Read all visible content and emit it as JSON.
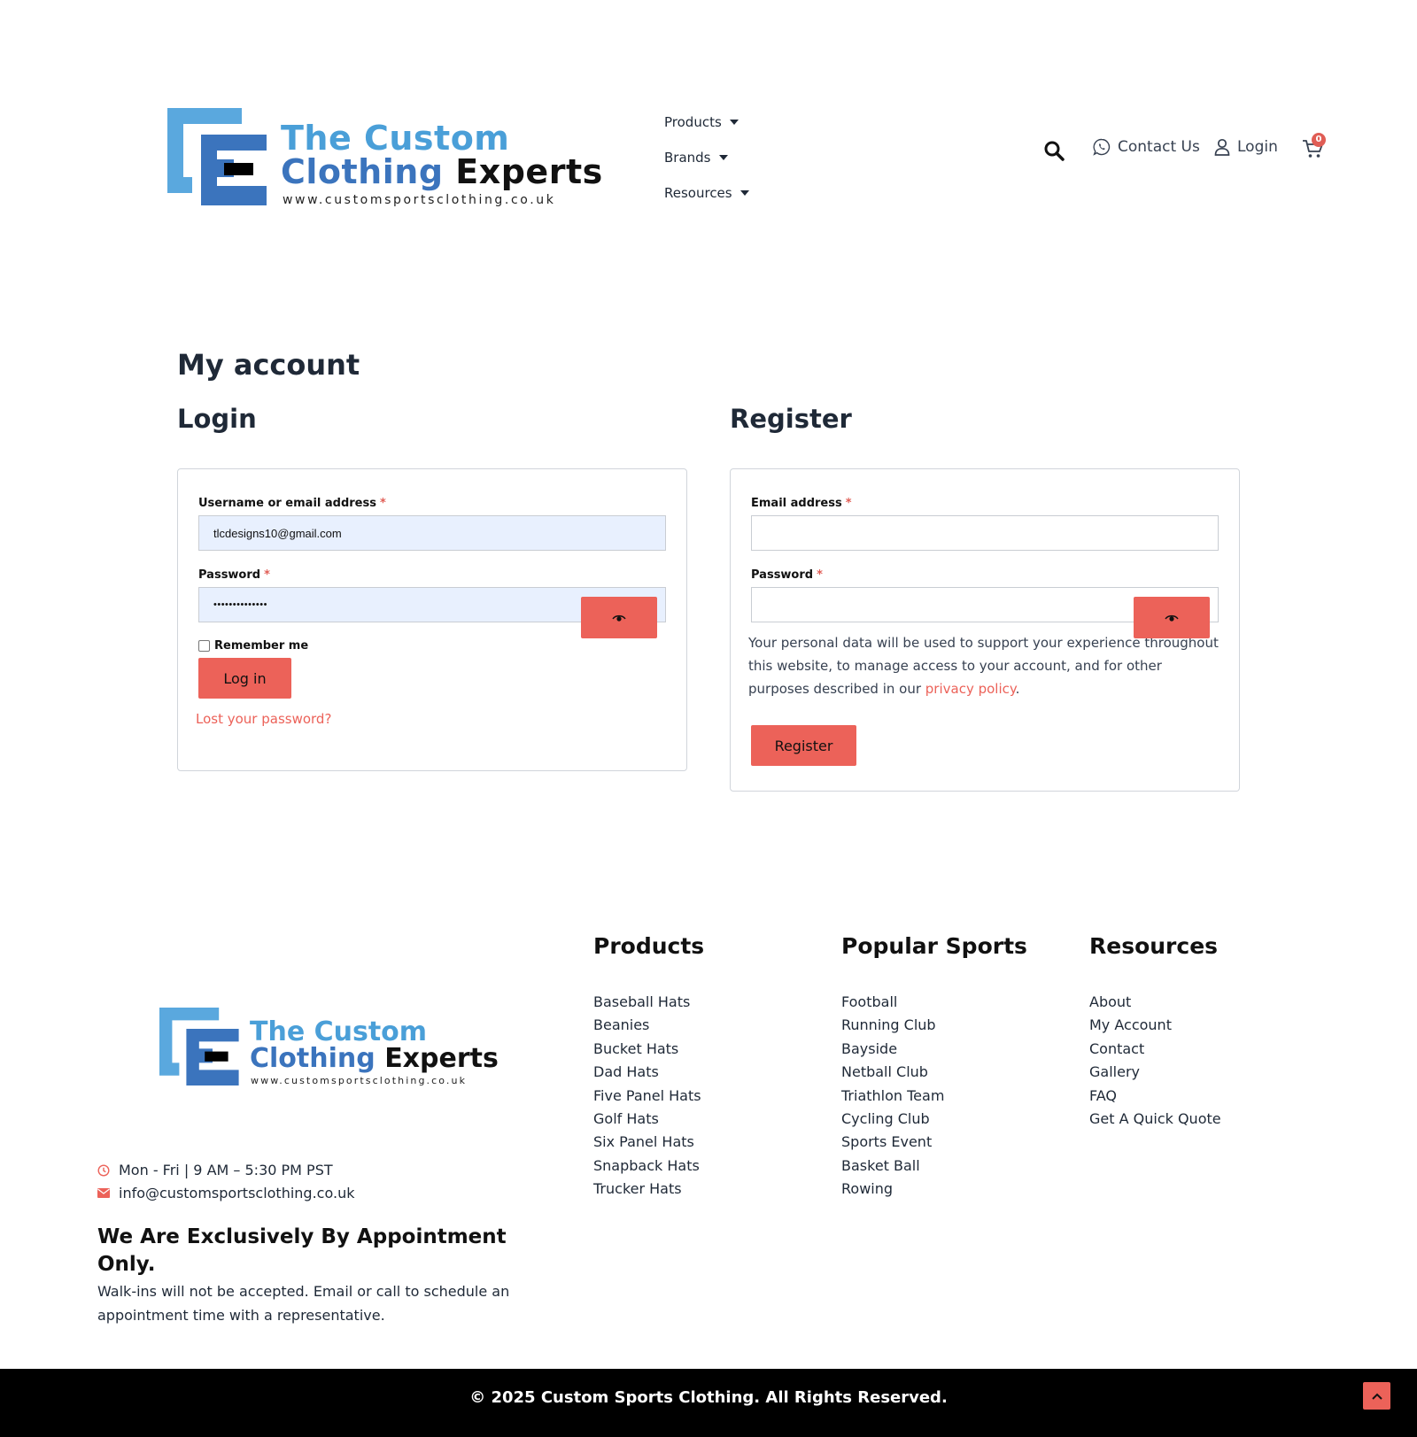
{
  "brand": {
    "line1": "The Custom",
    "line2_colored": "Clothing",
    "line2_dark": "Experts",
    "url": "www.customsportsclothing.co.uk"
  },
  "nav": {
    "products": "Products",
    "brands": "Brands",
    "resources": "Resources",
    "contact": "Contact Us",
    "login": "Login",
    "cart_count": "0"
  },
  "page": {
    "title": "My account"
  },
  "login": {
    "title": "Login",
    "username_label": "Username or email address",
    "username_value": "tlcdesigns10@gmail.com",
    "password_label": "Password",
    "password_value": "••••••••••••••",
    "remember_label": "Remember me",
    "submit_label": "Log in",
    "lost_password": "Lost your password?"
  },
  "register": {
    "title": "Register",
    "email_label": "Email address",
    "password_label": "Password",
    "privacy_text": "Your personal data will be used to support your experience throughout this website, to manage access to your account, and for other purposes described in our ",
    "privacy_link": "privacy policy",
    "privacy_end": ".",
    "submit_label": "Register"
  },
  "required_mark": "*",
  "footer": {
    "hours": "Mon - Fri | 9 AM – 5:30 PM PST",
    "email": "info@customsportsclothing.co.uk",
    "appointment_title": "We Are Exclusively By Appointment Only.",
    "appointment_body": "Walk-ins will not be accepted. Email or call to schedule an appointment time with a representative.",
    "columns": [
      {
        "title": "Products",
        "items": [
          "Baseball Hats",
          "Beanies",
          "Bucket Hats",
          "Dad Hats",
          "Five Panel Hats",
          "Golf Hats",
          "Six Panel Hats",
          "Snapback Hats",
          "Trucker Hats"
        ]
      },
      {
        "title": "Popular Sports",
        "items": [
          "Football",
          "Running Club",
          "Bayside",
          "Netball Club",
          "Triathlon Team",
          "Cycling Club",
          "Sports Event",
          "Basket Ball",
          "Rowing"
        ]
      },
      {
        "title": "Resources",
        "items": [
          "About",
          "My Account",
          "Contact",
          "Gallery",
          "FAQ",
          "Get A Quick Quote"
        ]
      }
    ],
    "copyright": "© 2025 Custom Sports Clothing. All Rights Reserved."
  },
  "colors": {
    "accent": "#ec6259",
    "brand_light_blue": "#4a9fd8",
    "brand_dark_blue": "#3b74bd",
    "autofill_bg": "#e8f0fe",
    "footer_bar": "#000000"
  },
  "icons": [
    "search-icon",
    "whatsapp-icon",
    "user-icon",
    "cart-icon",
    "eye-icon",
    "clock-icon",
    "envelope-icon",
    "chevron-up-icon"
  ]
}
